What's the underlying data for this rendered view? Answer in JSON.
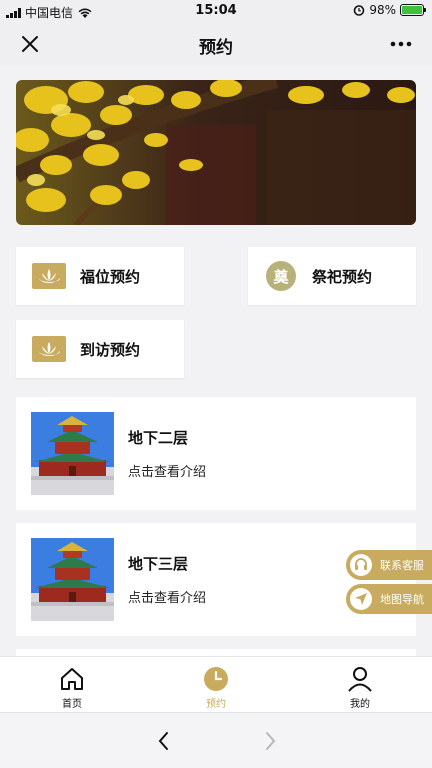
{
  "status_bar": {
    "carrier": "中国电信",
    "time": "15:04",
    "battery": "98%",
    "battery_level": 0.98
  },
  "header": {
    "title": "预约",
    "close_icon": "close-icon",
    "more_icon": "more-icon"
  },
  "banner": {
    "image": "ginkgo-leaves-banner"
  },
  "tiles": [
    {
      "label": "福位预约",
      "icon": "lotus-icon"
    },
    {
      "label": "祭祀预约",
      "icon": "dian-character-icon",
      "icon_text": "奠"
    },
    {
      "label": "到访预约",
      "icon": "lotus-icon"
    }
  ],
  "floors": [
    {
      "title": "地下二层",
      "subtitle": "点击查看介绍",
      "image": "pagoda-photo"
    },
    {
      "title": "地下三层",
      "subtitle": "点击查看介绍",
      "image": "pagoda-photo"
    }
  ],
  "floating": {
    "service": "联系客服",
    "navigation": "地图导航"
  },
  "tabbar": {
    "home": "首页",
    "booking": "预约",
    "mine": "我的"
  },
  "colors": {
    "accent": "#c8ab5e",
    "background": "#f2f2f5",
    "card": "#ffffff"
  }
}
